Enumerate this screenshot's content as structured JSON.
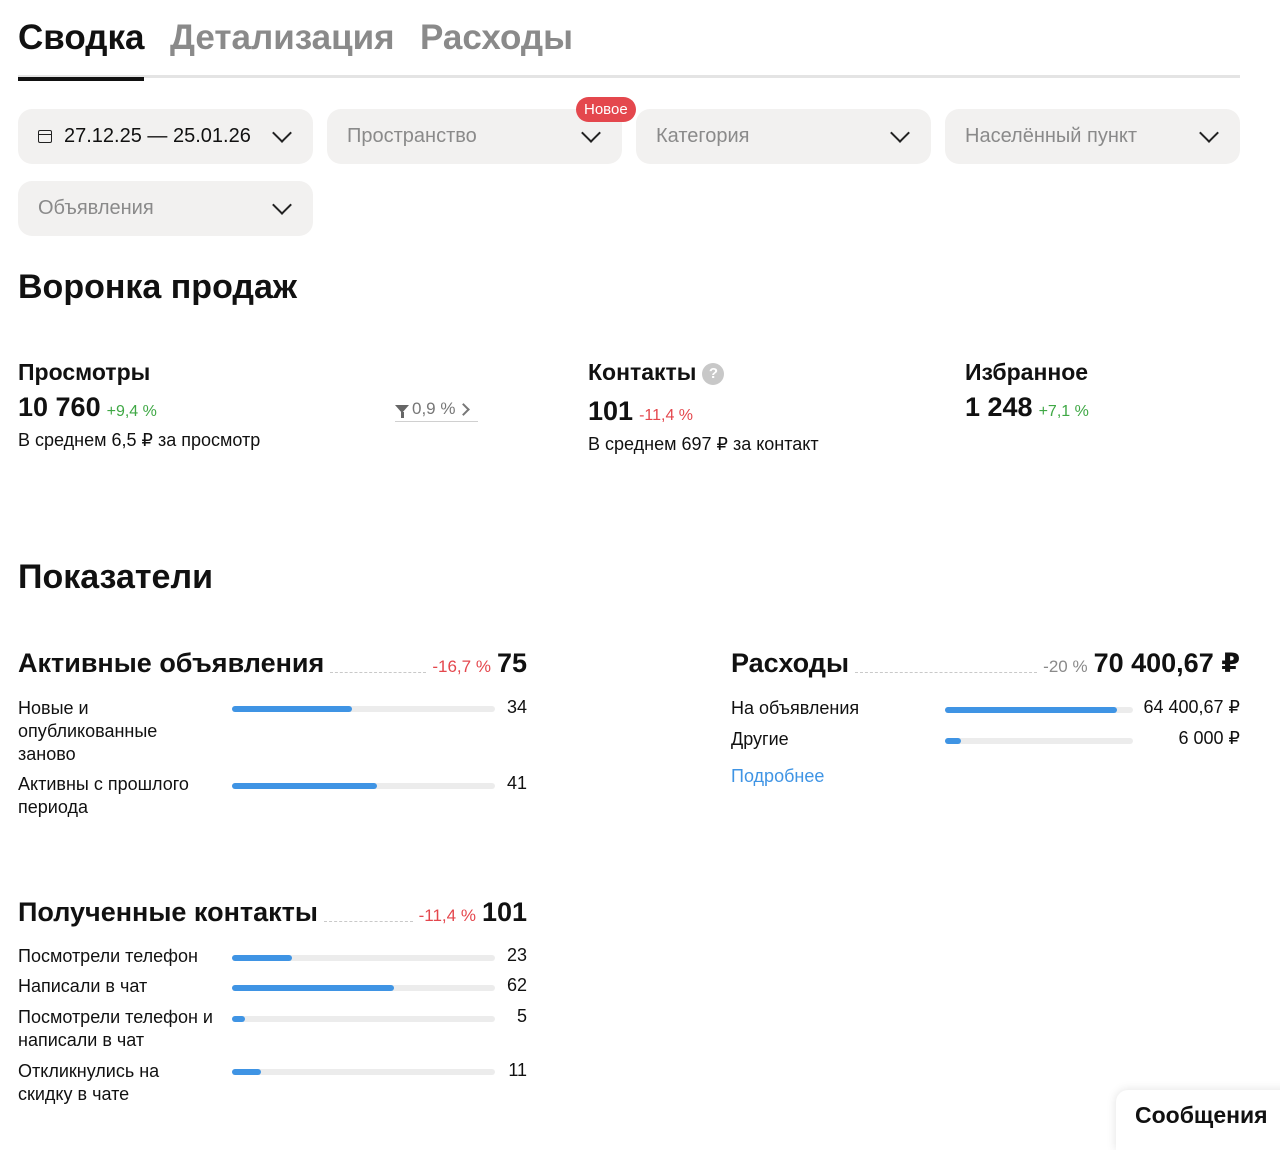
{
  "tabs": [
    {
      "label": "Сводка",
      "active": true
    },
    {
      "label": "Детализация",
      "active": false
    },
    {
      "label": "Расходы",
      "active": false
    }
  ],
  "filters": {
    "date": "27.12.25 — 25.01.26",
    "space": "Пространство",
    "space_badge": "Новое",
    "category": "Категория",
    "location": "Населённый пункт",
    "listings": "Объявления"
  },
  "funnel": {
    "title": "Воронка продаж",
    "views": {
      "title": "Просмотры",
      "value": "10 760",
      "delta": "+9,4 %",
      "sub": "В среднем 6,5 ₽ за просмотр"
    },
    "conversion": "0,9 %",
    "contacts": {
      "title": "Контакты",
      "help": "?",
      "value": "101",
      "delta": "-11,4 %",
      "sub": "В среднем 697 ₽ за контакт"
    },
    "favorites": {
      "title": "Избранное",
      "value": "1 248",
      "delta": "+7,1 %"
    }
  },
  "indicators": {
    "title": "Показатели",
    "active_listings": {
      "title": "Активные объявления",
      "delta": "-16,7 %",
      "value": "75",
      "rows": [
        {
          "label": "Новые и опубликованные заново",
          "value": "34",
          "fill": 0.455
        },
        {
          "label": "Активны с прошлого периода",
          "value": "41",
          "fill": 0.55
        }
      ]
    },
    "expenses": {
      "title": "Расходы",
      "delta": "-20 %",
      "value": "70 400,67 ₽",
      "rows": [
        {
          "label": "На объявления",
          "value": "64 400,67 ₽",
          "fill": 0.915
        },
        {
          "label": "Другие",
          "value": "6 000 ₽",
          "fill": 0.085
        }
      ],
      "more_link": "Подробнее"
    },
    "contacts": {
      "title": "Полученные контакты",
      "delta": "-11,4 %",
      "value": "101",
      "rows": [
        {
          "label": "Посмотрели телефон",
          "value": "23",
          "fill": 0.23
        },
        {
          "label": "Написали в чат",
          "value": "62",
          "fill": 0.615
        },
        {
          "label": "Посмотрели телефон и написали в чат",
          "value": "5",
          "fill": 0.05
        },
        {
          "label": "Откликнулись на скидку в чате",
          "value": "11",
          "fill": 0.11
        }
      ]
    }
  },
  "messages_button": "Сообщения",
  "colors": {
    "accent": "#3f94e4",
    "positive": "#3fa845",
    "negative": "#e4474d",
    "badge": "#e4474d"
  }
}
